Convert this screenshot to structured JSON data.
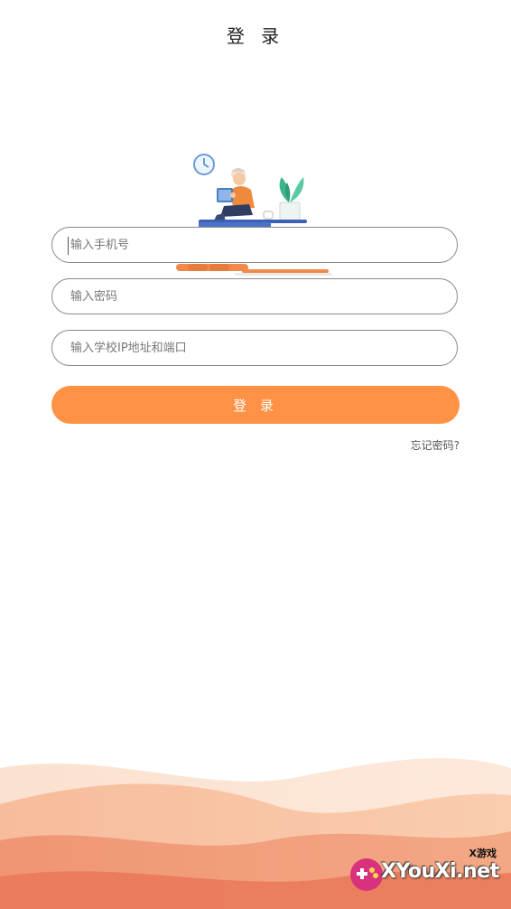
{
  "header": {
    "title": "登 录"
  },
  "form": {
    "phone_placeholder": "输入手机号",
    "password_placeholder": "输入密码",
    "school_placeholder": "输入学校IP地址和端口",
    "login_label": "登 录",
    "forgot_label": "忘记密码?"
  },
  "watermark": {
    "small_text": "X游戏",
    "main_text": "XYouXi.net"
  },
  "colors": {
    "accent": "#ff9245",
    "wave_light": "#fbd9c1",
    "wave_dark": "#ec7b58"
  }
}
